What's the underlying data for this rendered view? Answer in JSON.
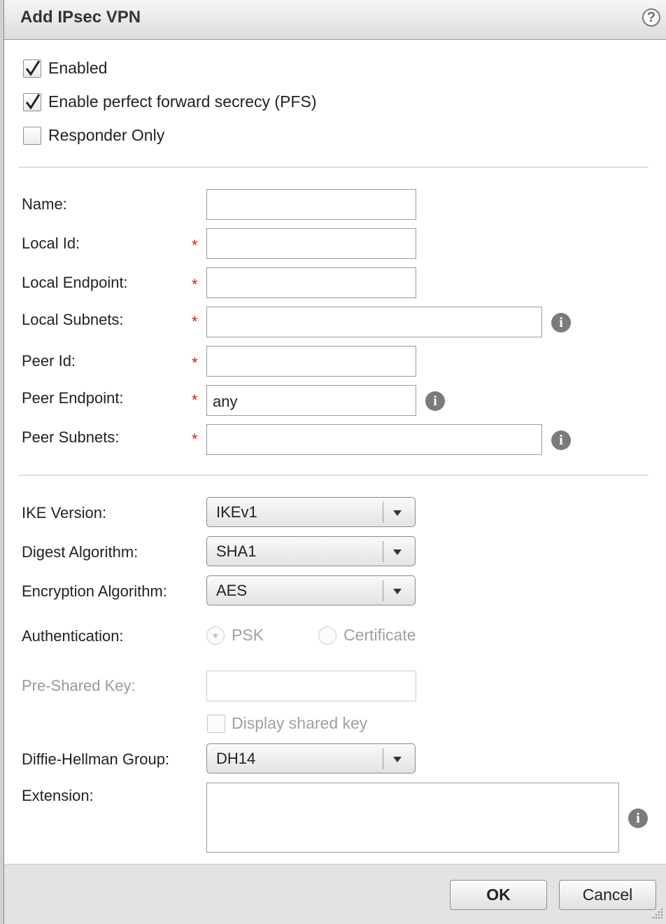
{
  "dialog": {
    "title": "Add IPsec VPN",
    "help_icon": "question-mark-icon",
    "help_glyph": "?"
  },
  "options": {
    "enabled": {
      "label": "Enabled",
      "checked": true
    },
    "pfs": {
      "label": "Enable perfect forward secrecy (PFS)",
      "checked": true
    },
    "responder_only": {
      "label": "Responder Only",
      "checked": false
    }
  },
  "required_marker": "*",
  "info_glyph": "i",
  "fields": {
    "name": {
      "label": "Name:",
      "value": ""
    },
    "local_id": {
      "label": "Local Id:",
      "value": ""
    },
    "local_endpoint": {
      "label": "Local Endpoint:",
      "value": ""
    },
    "local_subnets": {
      "label": "Local Subnets:",
      "value": ""
    },
    "peer_id": {
      "label": "Peer Id:",
      "value": ""
    },
    "peer_endpoint": {
      "label": "Peer Endpoint:",
      "value": "any"
    },
    "peer_subnets": {
      "label": "Peer Subnets:",
      "value": ""
    }
  },
  "ike": {
    "ike_version": {
      "label": "IKE Version:",
      "value": "IKEv1"
    },
    "digest_algorithm": {
      "label": "Digest Algorithm:",
      "value": "SHA1"
    },
    "encryption_algorithm": {
      "label": "Encryption Algorithm:",
      "value": "AES"
    },
    "authentication": {
      "label": "Authentication:",
      "options": [
        {
          "label": "PSK",
          "selected": true,
          "disabled": true
        },
        {
          "label": "Certificate",
          "selected": false,
          "disabled": true
        }
      ]
    },
    "pre_shared_key": {
      "label": "Pre-Shared Key:",
      "value": "",
      "disabled": true
    },
    "display_shared_key": {
      "label": "Display shared key",
      "checked": false,
      "disabled": true
    },
    "dh_group": {
      "label": "Diffie-Hellman Group:",
      "value": "DH14"
    },
    "extension": {
      "label": "Extension:",
      "value": ""
    }
  },
  "footer": {
    "ok_label": "OK",
    "cancel_label": "Cancel"
  },
  "colors": {
    "required": "#cc2222",
    "info_icon": "#7b7b7b",
    "titlebar": "#dcdcdc",
    "footer": "#e3e3e3"
  }
}
